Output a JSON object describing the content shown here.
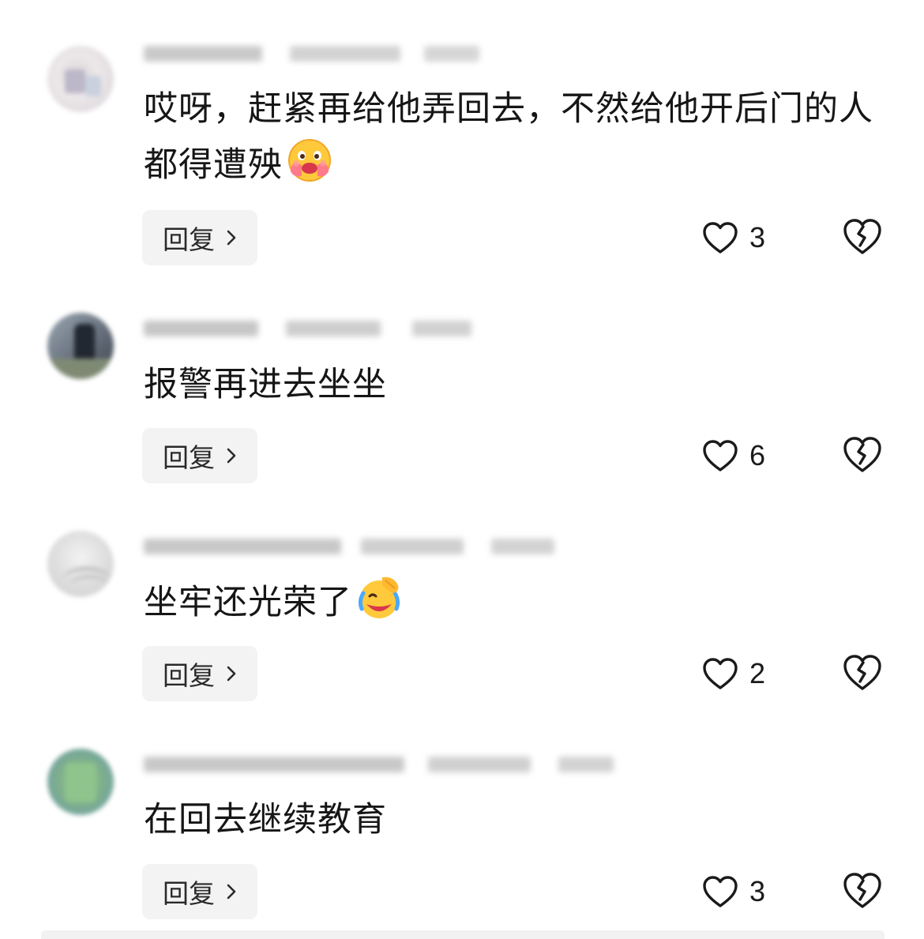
{
  "comments": [
    {
      "content": "哎呀，赶紧再给他弄回去，不然给他开后门的人都得遭殃",
      "emoji": "hugging-face-emoji",
      "reply_label": "回复",
      "likes": "3"
    },
    {
      "content": "报警再进去坐坐",
      "emoji": "",
      "reply_label": "回复",
      "likes": "6"
    },
    {
      "content": "坐牢还光荣了",
      "emoji": "laughing-crying-emoji",
      "reply_label": "回复",
      "likes": "2"
    },
    {
      "content": "在回去继续教育",
      "emoji": "",
      "reply_label": "回复",
      "likes": "3"
    }
  ],
  "colors": {
    "reply_bg": "#f3f3f4",
    "text": "#161616",
    "icon": "#1a1a1a"
  }
}
